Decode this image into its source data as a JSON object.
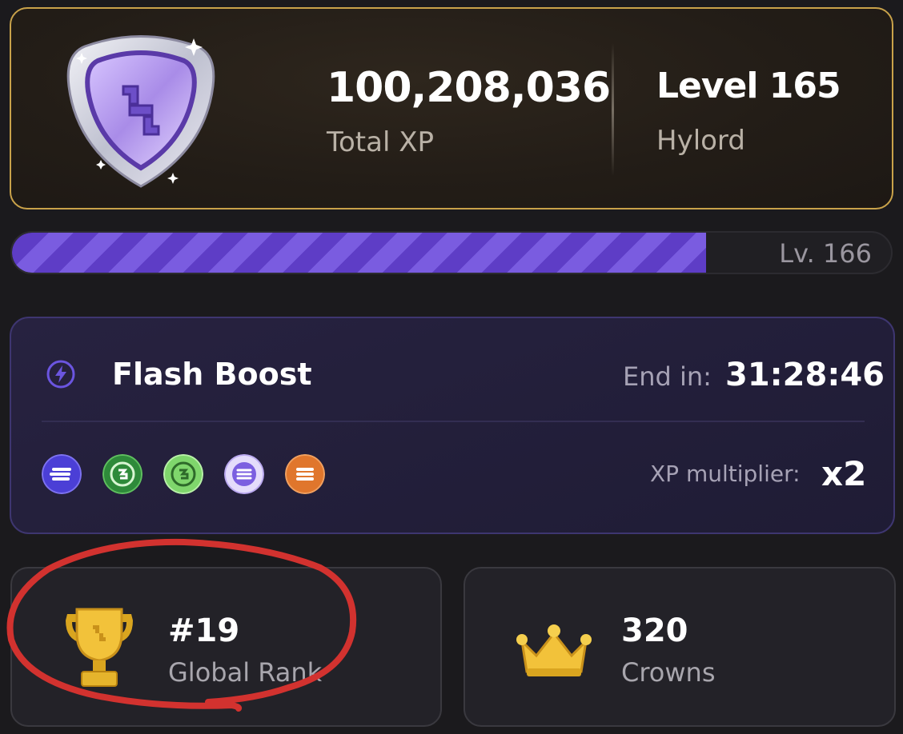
{
  "profile": {
    "total_xp": "100,208,036",
    "total_xp_label": "Total XP",
    "level": "Level 165",
    "level_title": "Hylord",
    "badge_icon": "shield-badge-icon"
  },
  "progress": {
    "next_level_label": "Lv. 166",
    "fill_percent": 79,
    "color": "#6a4cd4"
  },
  "flash_boost": {
    "title": "Flash Boost",
    "icon": "lightning-icon",
    "end_label": "End in:",
    "end_value": "31:28:46",
    "multiplier_label": "XP multiplier:",
    "multiplier_value": "x2",
    "coins": [
      {
        "name": "coin-blue-icon",
        "color": "#4b3fd6"
      },
      {
        "name": "coin-green-icon",
        "color": "#2e8a3a"
      },
      {
        "name": "coin-lightgreen-icon",
        "color": "#7fd66c"
      },
      {
        "name": "coin-lavender-icon",
        "color": "#cfc4f3"
      },
      {
        "name": "coin-orange-icon",
        "color": "#e0762c"
      }
    ]
  },
  "stats": {
    "rank_value": "#19",
    "rank_label": "Global Rank",
    "crowns_value": "320",
    "crowns_label": "Crowns"
  },
  "colors": {
    "gold_border": "#c9a24a",
    "purple_accent": "#5e3dc6",
    "annotation_red": "#d2322f"
  }
}
